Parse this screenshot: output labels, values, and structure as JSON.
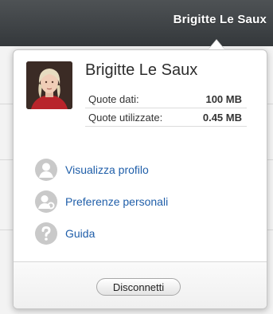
{
  "header": {
    "user_name": "Brigitte Le Saux"
  },
  "profile": {
    "name": "Brigitte Le Saux",
    "quota": [
      {
        "label": "Quote dati:",
        "value": "100 MB"
      },
      {
        "label": "Quote utilizzate:",
        "value": "0.45 MB"
      }
    ]
  },
  "menu": {
    "items": [
      {
        "label": "Visualizza profilo",
        "icon": "user-icon"
      },
      {
        "label": "Preferenze personali",
        "icon": "user-settings-icon"
      },
      {
        "label": "Guida",
        "icon": "help-icon"
      }
    ]
  },
  "footer": {
    "logout_label": "Disconnetti"
  },
  "colors": {
    "topbar": "#3a3e41",
    "link": "#1f5ea9",
    "icon_gray": "#c8c8c8"
  }
}
